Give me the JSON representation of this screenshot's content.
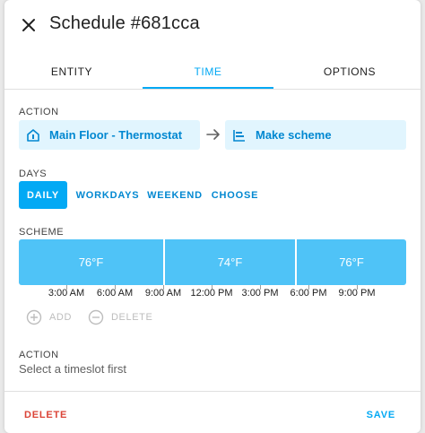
{
  "header": {
    "title": "Schedule #681cca",
    "close_icon": "close-icon"
  },
  "tabs": [
    {
      "label": "ENTITY",
      "active": false
    },
    {
      "label": "TIME",
      "active": true
    },
    {
      "label": "OPTIONS",
      "active": false
    }
  ],
  "action_section": {
    "label": "ACTION",
    "entity": {
      "label": "Main Floor - Thermostat",
      "icon": "home-thermostat-icon"
    },
    "arrow_icon": "arrow-right-icon",
    "service": {
      "label": "Make scheme",
      "icon": "timeline-icon"
    }
  },
  "days_section": {
    "label": "DAYS",
    "options": [
      "DAILY",
      "WORKDAYS",
      "WEEKEND",
      "CHOOSE"
    ],
    "selected": "DAILY"
  },
  "scheme_section": {
    "label": "SCHEME",
    "slots": [
      {
        "value": "76°F"
      },
      {
        "value": "74°F"
      },
      {
        "value": "76°F"
      }
    ],
    "time_labels": [
      "3:00 AM",
      "6:00 AM",
      "9:00 AM",
      "12:00 PM",
      "3:00 PM",
      "6:00 PM",
      "9:00 PM"
    ],
    "add_label": "ADD",
    "delete_label": "DELETE"
  },
  "slot_action": {
    "label": "ACTION",
    "placeholder": "Select a timeslot first"
  },
  "footer": {
    "delete_label": "DELETE",
    "save_label": "SAVE"
  },
  "colors": {
    "accent": "#03a9f4",
    "chip_bg": "#e1f5fe",
    "slot": "#4fc3f7",
    "danger": "#db4437"
  }
}
